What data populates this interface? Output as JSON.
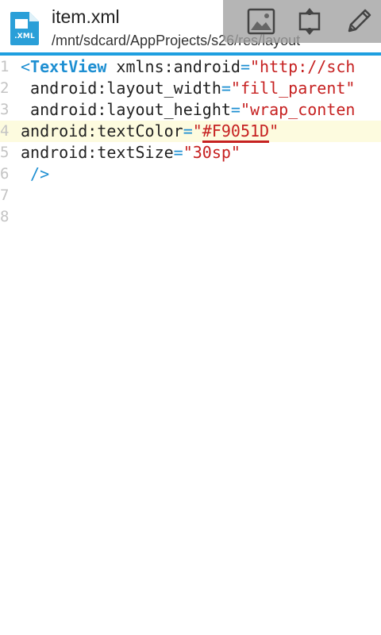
{
  "header": {
    "file_badge": ".XML",
    "file_name": "item.xml",
    "file_path": "/mnt/sdcard/AppProjects/s26/res/layout"
  },
  "toolbar": {
    "buttons": [
      {
        "icon": "image-icon"
      },
      {
        "icon": "fit-screen-icon"
      },
      {
        "icon": "pencil-icon"
      }
    ]
  },
  "colors": {
    "accent": "#1e9fe0",
    "tag": "#1e8fd2",
    "string": "#c62121",
    "current_line": "#fdfbdf"
  },
  "editor": {
    "current_line": 4,
    "lines": [
      {
        "num": "1",
        "tokens": [
          {
            "t": "<",
            "k": "t-punct"
          },
          {
            "t": "TextView",
            "k": "t-tag"
          },
          {
            "t": " xmlns:android",
            "k": "t-attr"
          },
          {
            "t": "=",
            "k": "t-punct"
          },
          {
            "t": "\"http://sch",
            "k": "t-str"
          }
        ]
      },
      {
        "num": "2",
        "tokens": [
          {
            "t": " android:layout_width",
            "k": "t-attr"
          },
          {
            "t": "=",
            "k": "t-punct"
          },
          {
            "t": "\"fill_parent\"",
            "k": "t-str"
          }
        ]
      },
      {
        "num": "3",
        "tokens": [
          {
            "t": " android:layout_height",
            "k": "t-attr"
          },
          {
            "t": "=",
            "k": "t-punct"
          },
          {
            "t": "\"wrap_conten",
            "k": "t-str"
          }
        ]
      },
      {
        "num": "4",
        "tokens": [
          {
            "t": "android:textColor",
            "k": "t-attr"
          },
          {
            "t": "=",
            "k": "t-punct"
          },
          {
            "t": "\"",
            "k": "t-str"
          },
          {
            "t": "#F9051D",
            "k": "t-err"
          },
          {
            "t": "\"",
            "k": "t-str"
          }
        ]
      },
      {
        "num": "5",
        "tokens": [
          {
            "t": "android:textSize",
            "k": "t-attr"
          },
          {
            "t": "=",
            "k": "t-punct"
          },
          {
            "t": "\"30sp\"",
            "k": "t-str"
          }
        ]
      },
      {
        "num": "6",
        "tokens": [
          {
            "t": " />",
            "k": "t-punct"
          }
        ]
      },
      {
        "num": "7",
        "tokens": []
      },
      {
        "num": "8",
        "tokens": []
      }
    ]
  }
}
